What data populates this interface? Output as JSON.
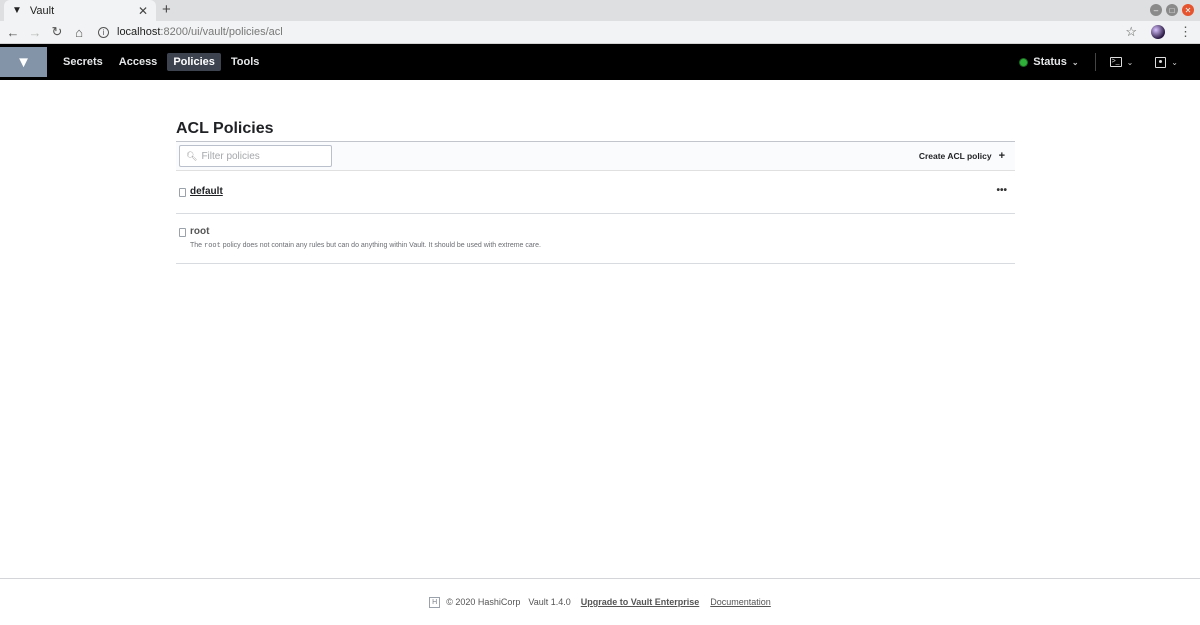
{
  "browser": {
    "tab_title": "Vault",
    "url_host": "localhost",
    "url_path": ":8200/ui/vault/policies/acl"
  },
  "nav": {
    "items": [
      {
        "label": "Secrets",
        "active": false
      },
      {
        "label": "Access",
        "active": false
      },
      {
        "label": "Policies",
        "active": true
      },
      {
        "label": "Tools",
        "active": false
      }
    ],
    "status_label": "Status",
    "status_color": "#2eb039"
  },
  "page": {
    "title": "ACL Policies",
    "filter_placeholder": "Filter policies",
    "create_label": "Create ACL policy"
  },
  "policies": [
    {
      "name": "default",
      "description": "",
      "has_menu": true
    },
    {
      "name": "root",
      "description_pre": "The ",
      "description_code": "root",
      "description_post": " policy does not contain any rules but can do anything within Vault. It should be used with extreme care."
    }
  ],
  "footer": {
    "copyright": "© 2020 HashiCorp",
    "version": "Vault 1.4.0",
    "upgrade_link": "Upgrade to Vault Enterprise",
    "docs_link": "Documentation"
  },
  "colors": {
    "nav_bg": "#000000",
    "logo_bg": "#8393a8",
    "active_nav_bg": "#3d4450"
  }
}
